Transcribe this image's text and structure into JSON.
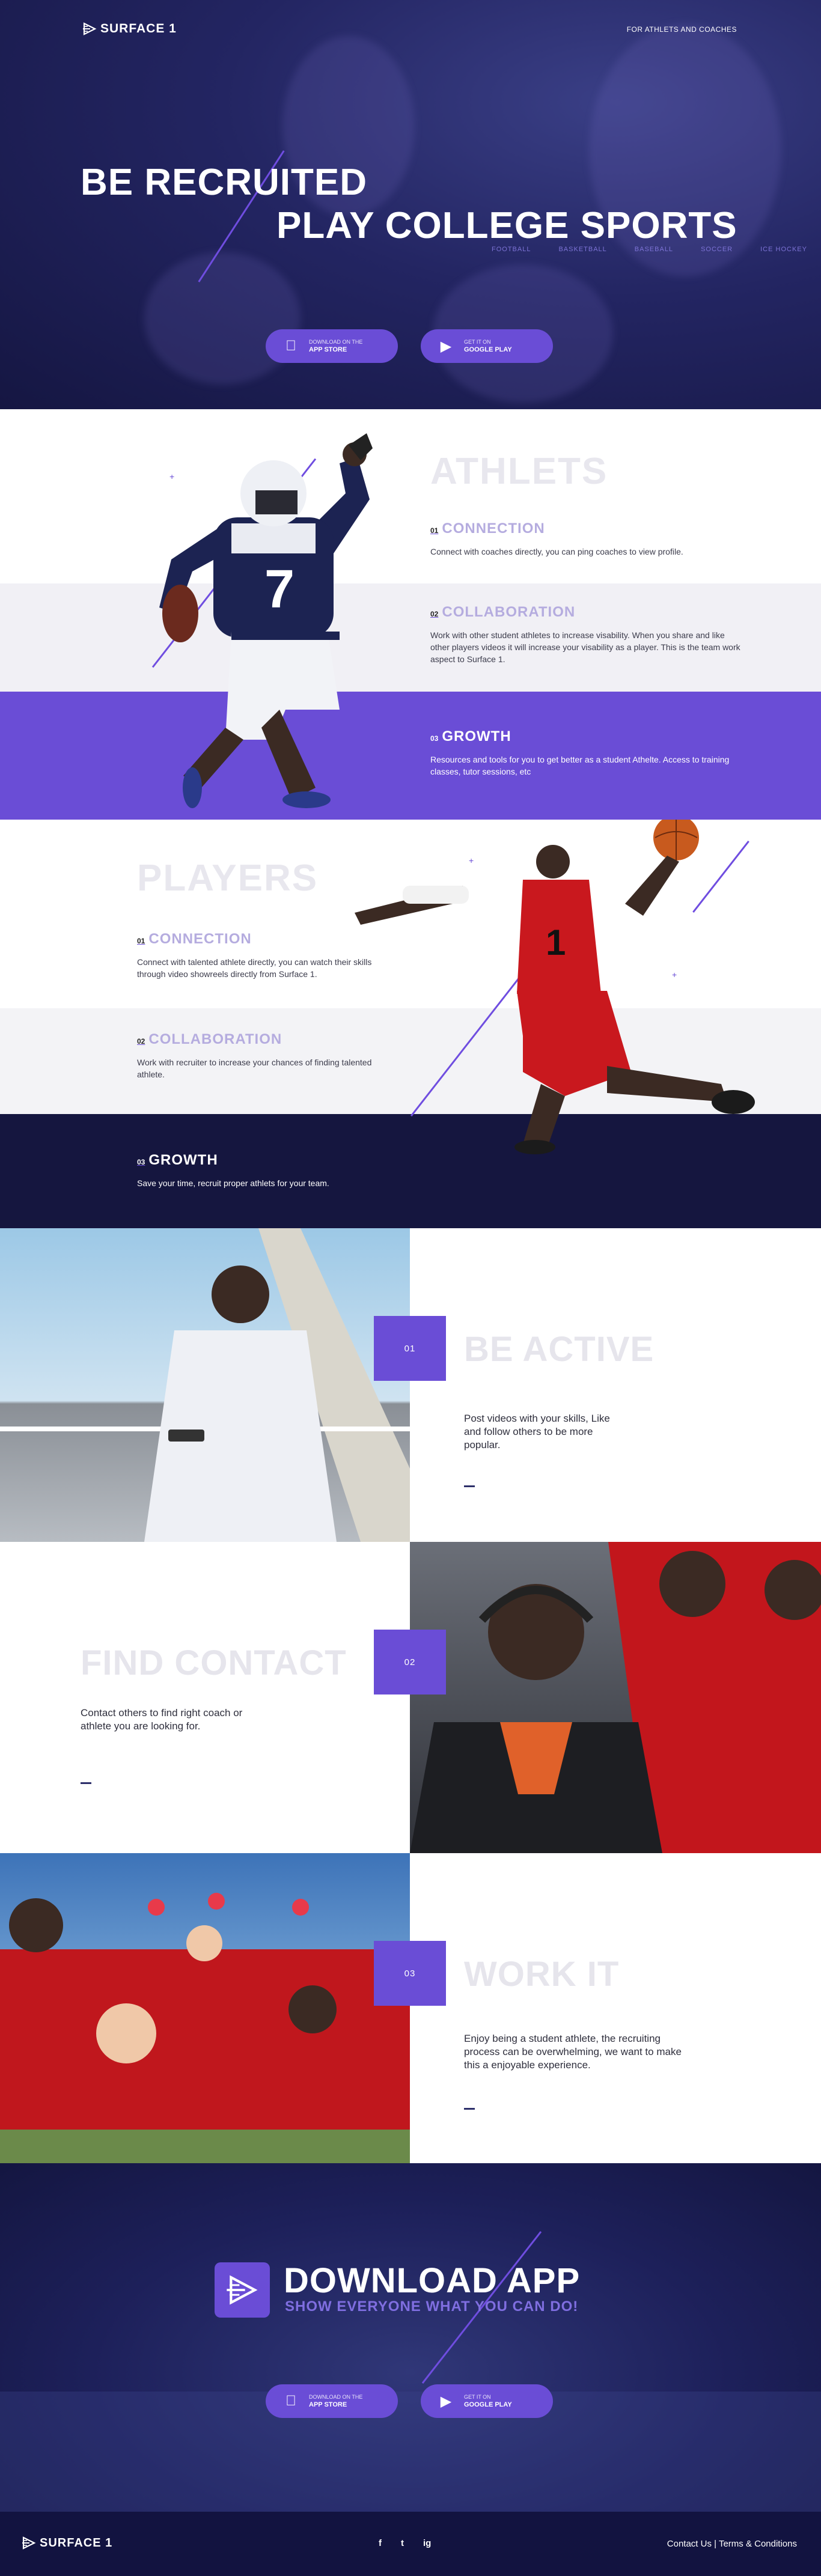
{
  "header": {
    "logo": "SURFACE 1",
    "tagline": "FOR ATHLETS AND COACHES"
  },
  "hero": {
    "title_line1": "BE RECRUITED",
    "title_line2": "PLAY COLLEGE SPORTS",
    "sports": [
      "FOOTBALL",
      "BASKETBALL",
      "BASEBALL",
      "SOCCER",
      "ICE HOCKEY"
    ]
  },
  "store_buttons": {
    "appstore_small": "DOWNLOAD ON THE",
    "appstore_big": "APP STORE",
    "googleplay_small": "GET IT ON",
    "googleplay_big": "GOOGLE PLAY"
  },
  "athletes": {
    "title": "ATHLETS",
    "features": [
      {
        "num": "01",
        "title": "CONNECTION",
        "desc": "Connect with coaches directly, you can ping coaches to view profile."
      },
      {
        "num": "02",
        "title": "COLLABORATION",
        "desc": "Work with other student athletes to  increase visability. When you share and like other players videos it will increase your visability as a player. This is the team work aspect to Surface 1."
      },
      {
        "num": "03",
        "title": "GROWTH",
        "desc": "Resources and tools for you to get better as a student Athelte. Access to training classes, tutor sessions, etc"
      }
    ],
    "jersey": "7"
  },
  "players": {
    "title": "PLAYERS",
    "features": [
      {
        "num": "01",
        "title": "CONNECTION",
        "desc": "Connect with talented athlete directly, you can watch their skills through video showreels directly from Surface 1."
      },
      {
        "num": "02",
        "title": "COLLABORATION",
        "desc": "Work with recruiter to increase your chances of finding talented athlete."
      },
      {
        "num": "03",
        "title": "GROWTH",
        "desc": "Save your time, recruit proper athlets for your team."
      }
    ],
    "jersey": "1"
  },
  "steps": [
    {
      "num": "01",
      "title": "BE ACTIVE",
      "desc": "Post videos with your skills, Like and follow others to be more popular."
    },
    {
      "num": "02",
      "title": "FIND CONTACT",
      "desc": "Contact others to find right coach or athlete you are looking for."
    },
    {
      "num": "03",
      "title": "WORK IT",
      "desc": "Enjoy being a student athlete, the recruiting process can be overwhelming, we want to make this a enjoyable experience."
    }
  ],
  "download": {
    "title": "DOWNLOAD APP",
    "subtitle": "SHOW EVERYONE WHAT YOU CAN DO!"
  },
  "footer": {
    "logo": "SURFACE 1",
    "social": [
      "f",
      "t",
      "ig"
    ],
    "contact": "Contact Us",
    "separator": " | ",
    "terms": "Terms & Conditions"
  },
  "colors": {
    "accent": "#6a4dd6",
    "hero_bg": "#1c1e55",
    "growth_band": "#6a4dd6",
    "players_growth_band": "#15163f",
    "collab_band": "#f1f0f5"
  }
}
